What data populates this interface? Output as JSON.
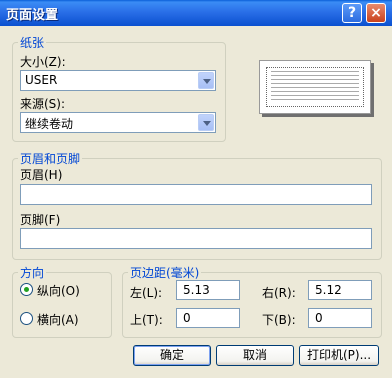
{
  "window": {
    "title": "页面设置",
    "help": "?",
    "close": "×"
  },
  "paper": {
    "group_title": "纸张",
    "size_label": "大小(Z):",
    "size_value": "USER",
    "source_label": "来源(S):",
    "source_value": "继续卷动"
  },
  "header_footer": {
    "group_title": "页眉和页脚",
    "header_label": "页眉(H)",
    "header_value": "",
    "footer_label": "页脚(F)",
    "footer_value": ""
  },
  "orientation": {
    "group_title": "方向",
    "portrait_label": "纵向(O)",
    "landscape_label": "横向(A)",
    "selected": "portrait"
  },
  "margins": {
    "group_title": "页边距(毫米)",
    "left_label": "左(L):",
    "left_value": "5.13",
    "right_label": "右(R):",
    "right_value": "5.12",
    "top_label": "上(T):",
    "top_value": "0",
    "bottom_label": "下(B):",
    "bottom_value": "0"
  },
  "buttons": {
    "ok": "确定",
    "cancel": "取消",
    "printer": "打印机(P)..."
  }
}
